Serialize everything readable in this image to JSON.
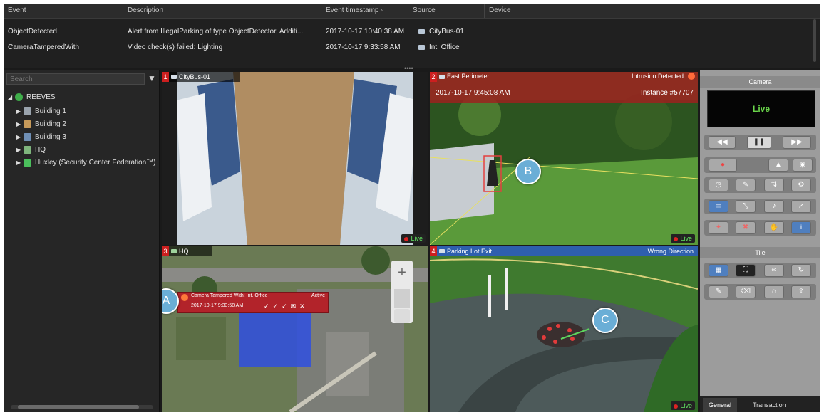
{
  "events": {
    "columns": [
      "Event",
      "Description",
      "Event timestamp",
      "Source",
      "Device"
    ],
    "sort_indicator": "˅",
    "rows": [
      {
        "event": "ObjectDetected",
        "description": "Alert from IllegalParking of type ObjectDetector. Additi...",
        "timestamp": "2017-10-17 10:40:38 AM",
        "source": "CityBus-01",
        "device": ""
      },
      {
        "event": "CameraTamperedWith",
        "description": "Video check(s) failed: Lighting",
        "timestamp": "2017-10-17 9:33:58 AM",
        "source": "Int. Office",
        "device": ""
      }
    ]
  },
  "tree": {
    "search_placeholder": "Search",
    "root": "REEVES",
    "items": [
      "Building 1",
      "Building 2",
      "Building 3",
      "HQ",
      "Huxley (Security Center Federation™)"
    ]
  },
  "tiles": [
    {
      "num": "1",
      "name": "CityBus-01",
      "live": "Live"
    },
    {
      "num": "2",
      "name": "East Perimeter",
      "alert": "Intrusion Detected",
      "timestamp": "2017-10-17 9:45:08 AM",
      "instance": "Instance #57707",
      "live": "Live",
      "callout": "B"
    },
    {
      "num": "3",
      "name": "HQ",
      "alarm_title": "Camera Tampered With: Int. Office",
      "alarm_time": "2017-10-17 9:33:58 AM",
      "alarm_state": "Active",
      "callout": "A",
      "zoom_in": "+",
      "zoom_out": "−"
    },
    {
      "num": "4",
      "name": "Parking Lot Exit",
      "alert": "Wrong Direction",
      "live": "Live",
      "callout": "C"
    }
  ],
  "panel": {
    "camera_title": "Camera",
    "live": "Live",
    "ptz_title": "Tile",
    "tabs": [
      "General",
      "Transaction"
    ]
  },
  "colors": {
    "accent_red": "#cc1f1f",
    "header_blue": "#2e5fae",
    "live_green": "#6ad64a",
    "callout": "#6aaed6"
  }
}
